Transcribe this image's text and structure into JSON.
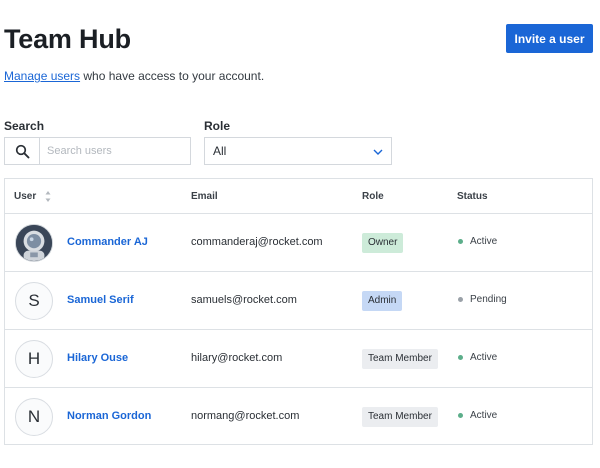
{
  "header": {
    "title": "Team Hub",
    "invite_label": "Invite a user"
  },
  "subtitle": {
    "link": "Manage users",
    "rest": " who have access to your account."
  },
  "filters": {
    "search_label": "Search",
    "search_placeholder": "Search users",
    "role_label": "Role",
    "role_value": "All"
  },
  "table": {
    "headers": {
      "user": "User",
      "email": "Email",
      "role": "Role",
      "status": "Status"
    },
    "rows": [
      {
        "initial": "",
        "avatar": "astronaut-photo",
        "name": "Commander AJ",
        "email": "commanderaj@rocket.com",
        "role": "Owner",
        "role_color": "#cdebd9",
        "status": "Active",
        "status_color": "#5cae8a"
      },
      {
        "initial": "S",
        "name": "Samuel Serif",
        "email": "samuels@rocket.com",
        "role": "Admin",
        "role_color": "#c5d8f5",
        "status": "Pending",
        "status_color": "#9aa1a8"
      },
      {
        "initial": "H",
        "name": "Hilary Ouse",
        "email": "hilary@rocket.com",
        "role": "Team Member",
        "role_color": "#ebedf0",
        "status": "Active",
        "status_color": "#5cae8a"
      },
      {
        "initial": "N",
        "name": "Norman Gordon",
        "email": "normang@rocket.com",
        "role": "Team Member",
        "role_color": "#ebedf0",
        "status": "Active",
        "status_color": "#5cae8a"
      }
    ]
  },
  "colors": {
    "accent": "#1a66d6"
  }
}
